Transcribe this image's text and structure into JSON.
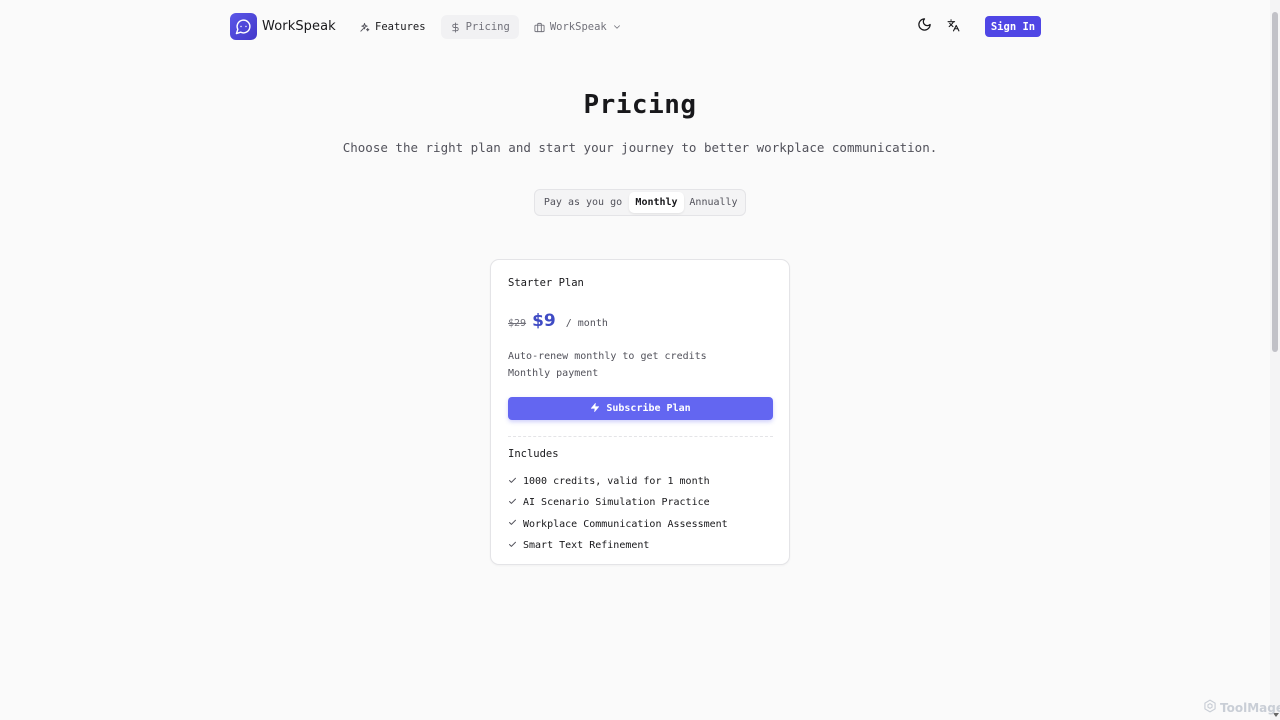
{
  "brand": {
    "name": "WorkSpeak",
    "accent": "#4f46e5",
    "button_color": "#6366f1",
    "price_color": "#3f4bc4"
  },
  "nav": {
    "items": [
      {
        "label": "Features",
        "icon": "sparkles-icon"
      },
      {
        "label": "Pricing",
        "icon": "dollar-icon"
      },
      {
        "label": "WorkSpeak",
        "icon": "briefcase-icon"
      }
    ]
  },
  "header": {
    "sign_in_label": "Sign In",
    "theme_icon": "moon-icon",
    "language_icon": "translate-icon"
  },
  "hero": {
    "title": "Pricing",
    "subtitle": "Choose the right plan and start your journey to better workplace communication."
  },
  "billing_toggle": {
    "options": [
      "Pay as you go",
      "Monthly",
      "Annually"
    ],
    "selected": "Monthly"
  },
  "plan": {
    "name": "Starter Plan",
    "original_price": "$29",
    "price": "$9",
    "period": "/ month",
    "description_lines": [
      "Auto-renew monthly to get credits",
      "Monthly payment"
    ],
    "cta_label": "Subscribe Plan",
    "includes_label": "Includes",
    "features": [
      "1000 credits, valid for 1 month",
      "AI Scenario Simulation Practice",
      "Workplace Communication Assessment",
      "Smart Text Refinement"
    ]
  },
  "watermark": {
    "text": "ToolMage"
  }
}
